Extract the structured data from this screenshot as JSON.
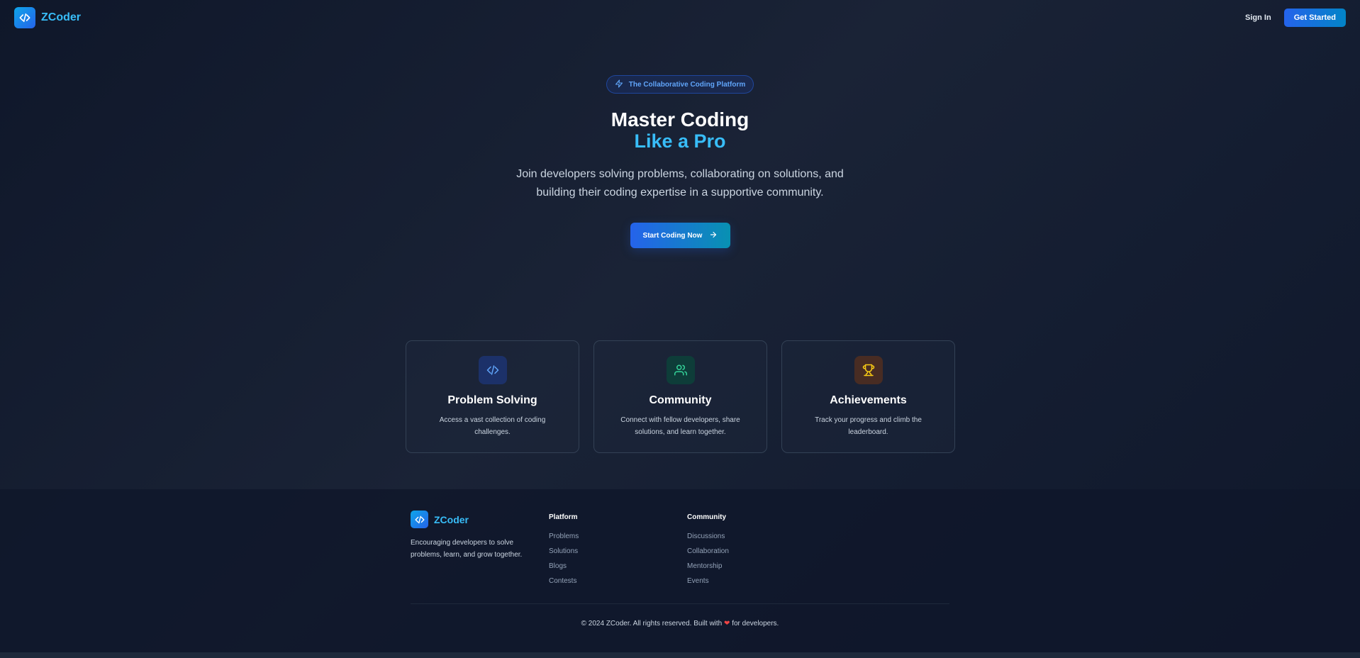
{
  "header": {
    "brand": "ZCoder",
    "signin_label": "Sign In",
    "get_started_label": "Get Started"
  },
  "hero": {
    "badge": "The Collaborative Coding Platform",
    "title_line1": "Master Coding",
    "title_line2": "Like a Pro",
    "subtitle": "Join developers solving problems, collaborating on solutions, and building their coding expertise in a supportive community.",
    "cta_label": "Start Coding Now"
  },
  "features": [
    {
      "icon": "code-icon",
      "title": "Problem Solving",
      "description": "Access a vast collection of coding challenges."
    },
    {
      "icon": "users-icon",
      "title": "Community",
      "description": "Connect with fellow developers, share solutions, and learn together."
    },
    {
      "icon": "trophy-icon",
      "title": "Achievements",
      "description": "Track your progress and climb the leaderboard."
    }
  ],
  "footer": {
    "brand": "ZCoder",
    "tagline": "Encouraging developers to solve problems, learn, and grow together.",
    "columns": [
      {
        "title": "Platform",
        "links": [
          "Problems",
          "Solutions",
          "Blogs",
          "Contests"
        ]
      },
      {
        "title": "Community",
        "links": [
          "Discussions",
          "Collaboration",
          "Mentorship",
          "Events"
        ]
      }
    ],
    "copyright_prefix": "© 2024 ZCoder. All rights reserved. Built with",
    "copyright_suffix": "for developers."
  },
  "colors": {
    "accent": "#38bdf8",
    "primary": "#2563eb",
    "background": "#0f172a",
    "heart": "#ef4444"
  }
}
